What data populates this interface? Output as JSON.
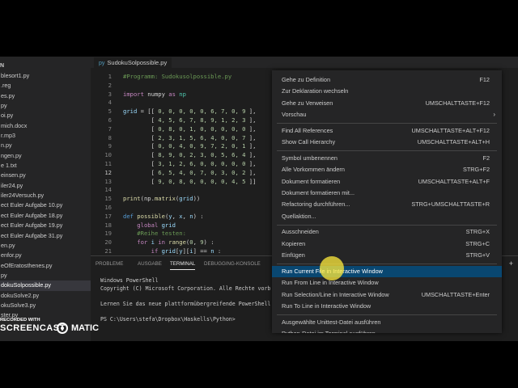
{
  "explorer": {
    "header": "N",
    "files": [
      "blesort1.py",
      ".reg",
      "es.py",
      "py",
      "oi.py",
      "mich.docx",
      "r.mp3",
      "n.py",
      "ngen.py",
      "e 1.txt",
      "einsen.py",
      "iler24.py",
      "iler24Versuch.py",
      "ect Euler Aufgabe 10.py",
      "ect Euler Aufgabe 18.py",
      "ect Euler Aufgabe 19.py",
      "ect Euler Aufgabe 31.py",
      "en.py",
      "enfor.py",
      "eOfEratosthenes.py",
      "py",
      "dokuSolpossible.py",
      "dokuSolve2.py",
      "okuSolve3.py",
      "ster.py"
    ],
    "active_index": 21
  },
  "editor": {
    "tab_icon": "py",
    "tab_label": "SudokuSolpossible.py",
    "current_line": 12,
    "lines": [
      {
        "n": "1",
        "t": [
          {
            "c": "c-com",
            "s": "#Programm: Sudokusolpossible.py"
          }
        ]
      },
      {
        "n": "2",
        "t": []
      },
      {
        "n": "3",
        "t": [
          {
            "c": "c-kw",
            "s": "import"
          },
          {
            "c": "",
            "s": " numpy "
          },
          {
            "c": "c-kw",
            "s": "as"
          },
          {
            "c": "c-cls",
            "s": " np"
          }
        ]
      },
      {
        "n": "4",
        "t": []
      },
      {
        "n": "5",
        "t": [
          {
            "c": "c-var",
            "s": "grid"
          },
          {
            "c": "",
            "s": " = [[ "
          },
          {
            "c": "c-num",
            "s": "0, 0, 0, 0, 0, 6, 7, 0, 9"
          },
          {
            "c": "",
            "s": " ],"
          }
        ]
      },
      {
        "n": "6",
        "t": [
          {
            "c": "",
            "s": "        [ "
          },
          {
            "c": "c-num",
            "s": "4, 5, 6, 7, 8, 9, 1, 2, 3"
          },
          {
            "c": "",
            "s": " ],"
          }
        ]
      },
      {
        "n": "7",
        "t": [
          {
            "c": "",
            "s": "        [ "
          },
          {
            "c": "c-num",
            "s": "0, 8, 0, 1, 0, 0, 0, 0, 0"
          },
          {
            "c": "",
            "s": " ],"
          }
        ]
      },
      {
        "n": "8",
        "t": [
          {
            "c": "",
            "s": "        [ "
          },
          {
            "c": "c-num",
            "s": "2, 3, 1, 5, 6, 4, 0, 0, 7"
          },
          {
            "c": "",
            "s": " ],"
          }
        ]
      },
      {
        "n": "9",
        "t": [
          {
            "c": "",
            "s": "        [ "
          },
          {
            "c": "c-num",
            "s": "0, 0, 4, 0, 9, 7, 2, 0, 1"
          },
          {
            "c": "",
            "s": " ],"
          }
        ]
      },
      {
        "n": "10",
        "t": [
          {
            "c": "",
            "s": "        [ "
          },
          {
            "c": "c-num",
            "s": "8, 9, 0, 2, 3, 0, 5, 6, 4"
          },
          {
            "c": "",
            "s": " ],"
          }
        ]
      },
      {
        "n": "11",
        "t": [
          {
            "c": "",
            "s": "        [ "
          },
          {
            "c": "c-num",
            "s": "3, 1, 2, 6, 0, 0, 0, 0, 0"
          },
          {
            "c": "",
            "s": " ],"
          }
        ]
      },
      {
        "n": "12",
        "t": [
          {
            "c": "",
            "s": "        [ "
          },
          {
            "c": "c-num",
            "s": "6, 5, 4, 0, 7, 0, 3, 0, 2"
          },
          {
            "c": "",
            "s": " ],"
          }
        ]
      },
      {
        "n": "13",
        "t": [
          {
            "c": "",
            "s": "        [ "
          },
          {
            "c": "c-num",
            "s": "9, 0, 8, 0, 0, 0, 0, 4, 5"
          },
          {
            "c": "",
            "s": " ]]"
          }
        ]
      },
      {
        "n": "14",
        "t": []
      },
      {
        "n": "15",
        "t": [
          {
            "c": "c-fn",
            "s": "print"
          },
          {
            "c": "",
            "s": "(np."
          },
          {
            "c": "c-fn",
            "s": "matrix"
          },
          {
            "c": "",
            "s": "("
          },
          {
            "c": "c-var",
            "s": "grid"
          },
          {
            "c": "",
            "s": "))"
          }
        ]
      },
      {
        "n": "16",
        "t": []
      },
      {
        "n": "17",
        "t": [
          {
            "c": "c-kw2",
            "s": "def"
          },
          {
            "c": "c-fn",
            "s": " possible"
          },
          {
            "c": "",
            "s": "("
          },
          {
            "c": "c-var",
            "s": "y"
          },
          {
            "c": "",
            "s": ", "
          },
          {
            "c": "c-var",
            "s": "x"
          },
          {
            "c": "",
            "s": ", "
          },
          {
            "c": "c-var",
            "s": "n"
          },
          {
            "c": "",
            "s": ") :"
          }
        ]
      },
      {
        "n": "18",
        "t": [
          {
            "c": "c-kw",
            "s": "    global"
          },
          {
            "c": "c-var",
            "s": " grid"
          }
        ]
      },
      {
        "n": "19",
        "t": [
          {
            "c": "c-com",
            "s": "    #Reihe testen:"
          }
        ]
      },
      {
        "n": "20",
        "t": [
          {
            "c": "c-kw",
            "s": "    for"
          },
          {
            "c": "c-var",
            "s": " i"
          },
          {
            "c": "c-kw",
            "s": " in"
          },
          {
            "c": "c-fn",
            "s": " range"
          },
          {
            "c": "",
            "s": "("
          },
          {
            "c": "c-num",
            "s": "0"
          },
          {
            "c": "",
            "s": ", "
          },
          {
            "c": "c-num",
            "s": "9"
          },
          {
            "c": "",
            "s": ") :"
          }
        ]
      },
      {
        "n": "21",
        "t": [
          {
            "c": "c-kw",
            "s": "        if"
          },
          {
            "c": "c-var",
            "s": " grid"
          },
          {
            "c": "",
            "s": "["
          },
          {
            "c": "c-var",
            "s": "y"
          },
          {
            "c": "",
            "s": "]["
          },
          {
            "c": "c-var",
            "s": "i"
          },
          {
            "c": "",
            "s": "] == "
          },
          {
            "c": "c-var",
            "s": "n"
          },
          {
            "c": "",
            "s": " :"
          }
        ]
      }
    ]
  },
  "panel": {
    "tabs": [
      "PROBLEME",
      "AUSGABE",
      "TERMINAL",
      "DEBUGGING-KONSOLE"
    ],
    "active_tab": "TERMINAL",
    "plus": "+",
    "terminal_lines": [
      "Windows PowerShell",
      "Copyright (C) Microsoft Corporation. Alle Rechte vorb",
      "",
      "Lernen Sie das neue plattformübergreifende PowerShell",
      "",
      "PS C:\\Users\\stefa\\Dropbox\\Haskells\\Python>"
    ]
  },
  "context_menu": {
    "groups": [
      [
        {
          "label": "Gehe zu Definition",
          "key": "F12"
        },
        {
          "label": "Zur Deklaration wechseln",
          "key": ""
        },
        {
          "label": "Gehe zu Verweisen",
          "key": "UMSCHALTTASTE+F12"
        },
        {
          "label": "Vorschau",
          "key": "",
          "submenu": true
        }
      ],
      [
        {
          "label": "Find All References",
          "key": "UMSCHALTTASTE+ALT+F12"
        },
        {
          "label": "Show Call Hierarchy",
          "key": "UMSCHALTTASTE+ALT+H"
        }
      ],
      [
        {
          "label": "Symbol umbenennen",
          "key": "F2"
        },
        {
          "label": "Alle Vorkommen ändern",
          "key": "STRG+F2"
        },
        {
          "label": "Dokument formatieren",
          "key": "UMSCHALTTASTE+ALT+F"
        },
        {
          "label": "Dokument formatieren mit...",
          "key": ""
        },
        {
          "label": "Refactoring durchführen...",
          "key": "STRG+UMSCHALTTASTE+R"
        },
        {
          "label": "Quellaktion...",
          "key": ""
        }
      ],
      [
        {
          "label": "Ausschneiden",
          "key": "STRG+X"
        },
        {
          "label": "Kopieren",
          "key": "STRG+C"
        },
        {
          "label": "Einfügen",
          "key": "STRG+V"
        }
      ],
      [
        {
          "label": "Run Current File in Interactive Window",
          "key": "",
          "selected": true
        },
        {
          "label": "Run From Line in Interactive Window",
          "key": ""
        },
        {
          "label": "Run Selection/Line in Interactive Window",
          "key": "UMSCHALTTASTE+Enter"
        },
        {
          "label": "Run To Line in Interactive Window",
          "key": ""
        }
      ],
      [
        {
          "label": "Ausgewählte Unittest-Datei ausführen",
          "key": ""
        },
        {
          "label": "Python-Datei im Terminal ausführen",
          "key": ""
        }
      ]
    ],
    "submenu_glyph": "›"
  },
  "watermark": {
    "recorded": "RECORDED WITH",
    "brand_left": "SCREENCAST",
    "brand_right": "MATIC"
  },
  "colors": {
    "menu_selection": "#094771",
    "cursor_highlight": "#ffeb3c"
  }
}
